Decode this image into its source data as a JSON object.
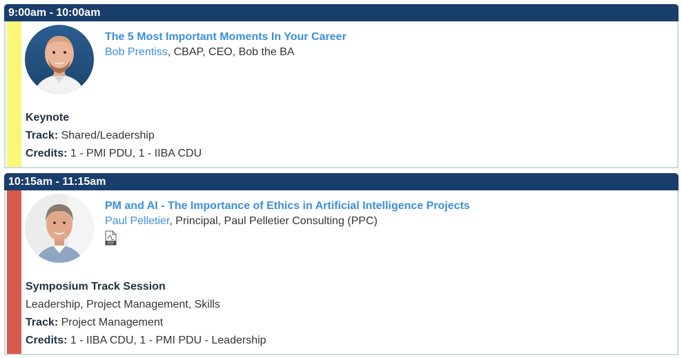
{
  "sessions": [
    {
      "time": "9:00am - 10:00am",
      "title": "The 5 Most Important Moments In Your Career",
      "speaker_name": "Bob Prentiss",
      "speaker_details": ", CBAP, CEO, Bob the BA",
      "type": "Keynote",
      "track_label": "Track:",
      "track": "Shared/Leadership",
      "credits_label": "Credits:",
      "credits": "1 - PMI PDU, 1 - IIBA CDU",
      "stripe_color": "#faf776"
    },
    {
      "time": "10:15am - 11:15am",
      "title": "PM and AI - The Importance of Ethics in Artificial Intelligence Projects",
      "speaker_name": "Paul Pelletier",
      "speaker_details": ", Principal, Paul Pelletier Consulting (PPC)",
      "attachment_icon": "pdf-icon",
      "attachment_label": "PDF",
      "type": "Symposium Track Session",
      "topics": "Leadership, Project Management, Skills",
      "track_label": "Track:",
      "track": "Project Management",
      "credits_label": "Credits:",
      "credits": "1 - IIBA CDU, 1 - PMI PDU - Leadership",
      "stripe_color": "#d65a4f"
    }
  ],
  "colors": {
    "header_bg": "#1a3e6b",
    "link": "#3a8fd9",
    "card_border": "#c7dce3"
  }
}
